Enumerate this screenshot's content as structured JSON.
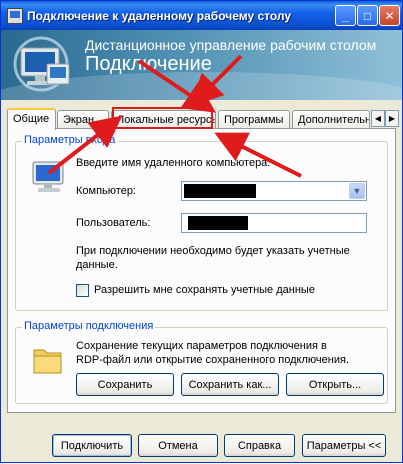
{
  "window": {
    "title": "Подключение к удаленному рабочему столу",
    "min_glyph": "_",
    "max_glyph": "□",
    "close_glyph": "✕"
  },
  "banner": {
    "line1": "Дистанционное управление рабочим столом",
    "line2": "Подключение"
  },
  "tabs": [
    {
      "label": "Общие",
      "active": true
    },
    {
      "label": "Экран",
      "active": false
    },
    {
      "label": "Локальные ресурсы",
      "active": false,
      "highlighted": true
    },
    {
      "label": "Программы",
      "active": false
    },
    {
      "label": "Дополнительно",
      "active": false
    }
  ],
  "tab_scroll": {
    "left": "◀",
    "right": "▶"
  },
  "logon_group": {
    "legend": "Параметры входа",
    "instruction": "Введите имя удаленного компьютера.",
    "computer_label": "Компьютер:",
    "computer_value": "",
    "dropdown_glyph": "▼",
    "user_label": "Пользователь:",
    "user_value": "",
    "note_line1": "При подключении необходимо будет указать учетные",
    "note_line2": "данные.",
    "save_credentials_label": "Разрешить мне сохранять учетные данные",
    "save_credentials_checked": false
  },
  "connection_group": {
    "legend": "Параметры подключения",
    "desc_line1": "Сохранение текущих параметров подключения в",
    "desc_line2": "RDP-файл или открытие сохраненного подключения.",
    "save_button": "Сохранить",
    "save_as_button": "Сохранить как...",
    "open_button": "Открыть..."
  },
  "footer": {
    "connect_button": "Подключить",
    "cancel_button": "Отмена",
    "help_button": "Справка",
    "options_button": "Параметры <<"
  },
  "colors": {
    "annotation": "#e01b1b",
    "legend_text": "#0046d5",
    "title_bar": "#0b4fcf"
  }
}
